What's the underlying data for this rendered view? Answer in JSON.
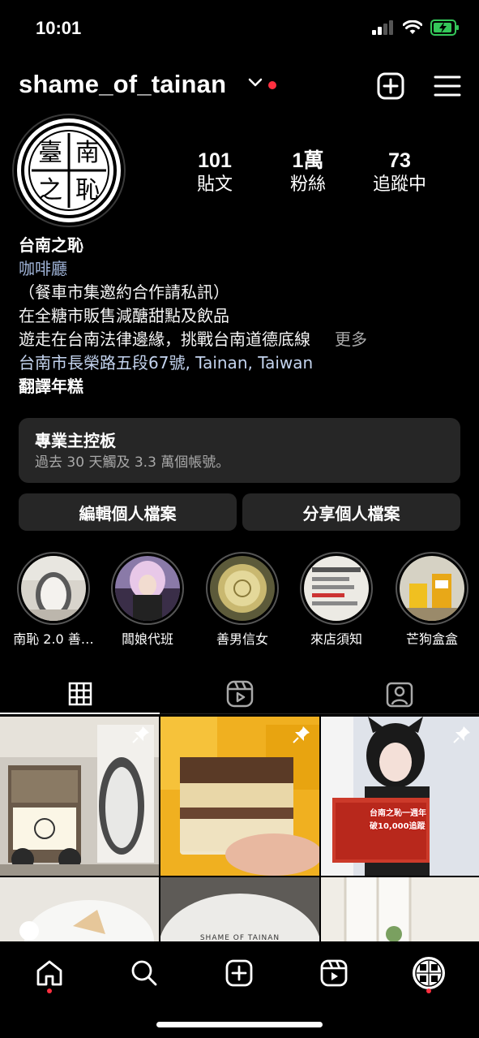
{
  "status": {
    "time": "10:01"
  },
  "header": {
    "username": "shame_of_tainan"
  },
  "profile": {
    "logo_text": "臺南之恥",
    "stats": [
      {
        "value": "101",
        "label": "貼文"
      },
      {
        "value": "1萬",
        "label": "粉絲"
      },
      {
        "value": "73",
        "label": "追蹤中"
      }
    ],
    "name": "台南之恥",
    "category": "咖啡廳",
    "bio_lines": [
      "（餐車市集邀約合作請私訊）",
      "在全糖市販售減醣甜點及飲品",
      "遊走在台南法律邊緣，挑戰台南道德底線"
    ],
    "more": "更多",
    "address": "台南市長榮路五段67號, Tainan, Taiwan",
    "translate": "翻譯年糕"
  },
  "dashboard": {
    "title": "專業主控板",
    "subtitle": "過去 30 天觸及 3.3 萬個帳號。"
  },
  "actions": {
    "edit": "編輯個人檔案",
    "share": "分享個人檔案"
  },
  "highlights": [
    {
      "label": "南恥 2.0 善…"
    },
    {
      "label": "闆娘代班"
    },
    {
      "label": "善男信女"
    },
    {
      "label": "來店須知"
    },
    {
      "label": "芒狗盒盒"
    }
  ],
  "grid_text": {
    "post3_caption1": "台南之恥一週年",
    "post3_caption2": "破10,000追蹤",
    "post4_text": "SHAME OF TAINAN"
  },
  "colors": {
    "background": "#000000",
    "card": "#262626",
    "link": "#c4d4ef",
    "notification": "#ff3040"
  }
}
